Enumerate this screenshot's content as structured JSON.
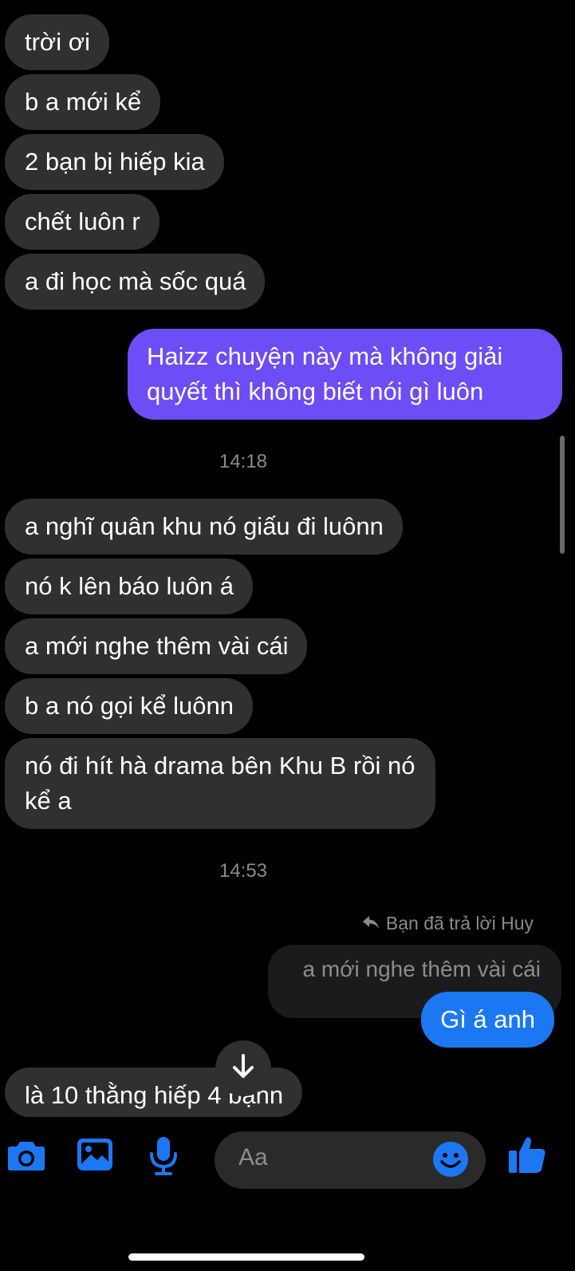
{
  "messages_before": [
    {
      "text": "trời ơi"
    },
    {
      "text": "b a mới kể"
    },
    {
      "text": "2 bạn bị hiếp kia"
    },
    {
      "text": "chết luôn r"
    },
    {
      "text": "a đi học mà sốc quá"
    }
  ],
  "sent_1": {
    "text": "Haizz chuyện này mà không giải quyết thì không biết nói gì luôn"
  },
  "time_1": "14:18",
  "messages_after": [
    {
      "text": "a nghĩ quân khu nó giấu đi luônn"
    },
    {
      "text": "nó k lên báo luôn á"
    },
    {
      "text": "a mới nghe thêm vài cái"
    },
    {
      "text": "b a nó gọi kể luônn"
    },
    {
      "text": "nó đi hít hà drama bên Khu B rồi nó kể a"
    }
  ],
  "time_2": "14:53",
  "reply": {
    "note": "Bạn đã trả lời Huy",
    "quoted": "a mới nghe thêm vài cái",
    "text": "Gì á anh"
  },
  "last_message": {
    "text": "là 10 thằng hiếp 4 bạnn"
  },
  "composer": {
    "placeholder": "Aa",
    "icons": [
      "camera-icon",
      "image-icon",
      "microphone-icon",
      "emoji-icon",
      "like-icon"
    ]
  },
  "colors": {
    "accent_blue": "#1c78f2",
    "sent_purple": "#6c4df6",
    "incoming_bubble": "#303030"
  }
}
